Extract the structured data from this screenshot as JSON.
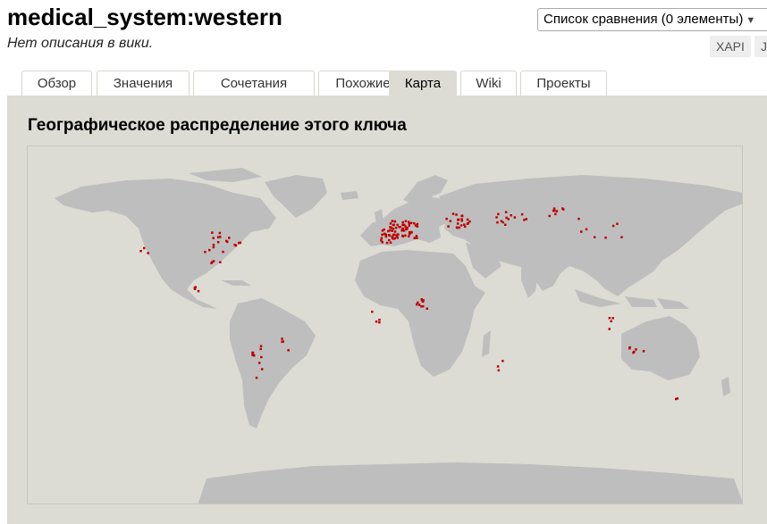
{
  "header": {
    "title": "medical_system:western",
    "description": "Нет описания в вики.",
    "compare_list": "Список сравнения (0 элементы)",
    "chips": [
      "XAPI",
      "J"
    ]
  },
  "tabs": [
    {
      "label": "Обзор",
      "active": false
    },
    {
      "label": "Значения",
      "active": false
    },
    {
      "label": "Сочетания",
      "active": false
    },
    {
      "label": "Похожие",
      "active": false
    },
    {
      "label": "Карта",
      "active": true
    },
    {
      "label": "Wiki",
      "active": false
    },
    {
      "label": "Проекты",
      "active": false
    }
  ],
  "map": {
    "heading": "Географическое распределение этого ключа",
    "land_color": "#bebebe",
    "ocean_color": "#dcdcd4",
    "point_color": "#c00000"
  }
}
